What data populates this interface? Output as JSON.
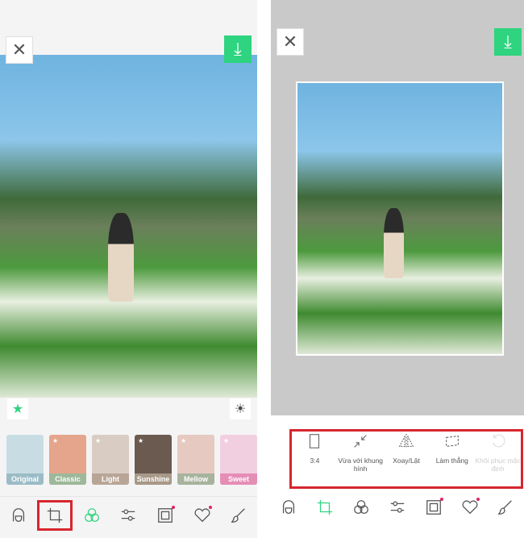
{
  "left": {
    "filters": [
      {
        "label": "Original",
        "color": "#9bbcc6",
        "bg": "#c8dde3",
        "star": false
      },
      {
        "label": "Classic",
        "color": "#9db89a",
        "bg": "#e5a58c",
        "star": true
      },
      {
        "label": "Light",
        "color": "#b9a597",
        "bg": "#d9cdc3",
        "star": true
      },
      {
        "label": "Sunshine",
        "color": "#a89888",
        "bg": "#6b5a50",
        "star": true
      },
      {
        "label": "Mellow",
        "color": "#a7b39c",
        "bg": "#e6c9c0",
        "star": true
      },
      {
        "label": "Sweet",
        "color": "#e58eb5",
        "bg": "#f2cfe0",
        "star": true
      }
    ],
    "active_tab": "crop"
  },
  "right": {
    "tools": [
      {
        "label": "3:4",
        "icon": "aspect-ratio-icon",
        "enabled": true
      },
      {
        "label": "Vừa với khung hình",
        "icon": "fit-frame-icon",
        "enabled": true
      },
      {
        "label": "Xoay/Lật",
        "icon": "rotate-flip-icon",
        "enabled": true
      },
      {
        "label": "Làm thẳng",
        "icon": "straighten-icon",
        "enabled": true
      },
      {
        "label": "Khôi phục mặc định",
        "icon": "reset-icon",
        "enabled": false
      }
    ]
  },
  "nav": [
    "face-icon",
    "crop-icon",
    "filter-icon",
    "adjust-icon",
    "frame-icon",
    "sticker-icon",
    "brush-icon"
  ],
  "colors": {
    "accent": "#2ed47f",
    "highlight": "#d7262e"
  }
}
